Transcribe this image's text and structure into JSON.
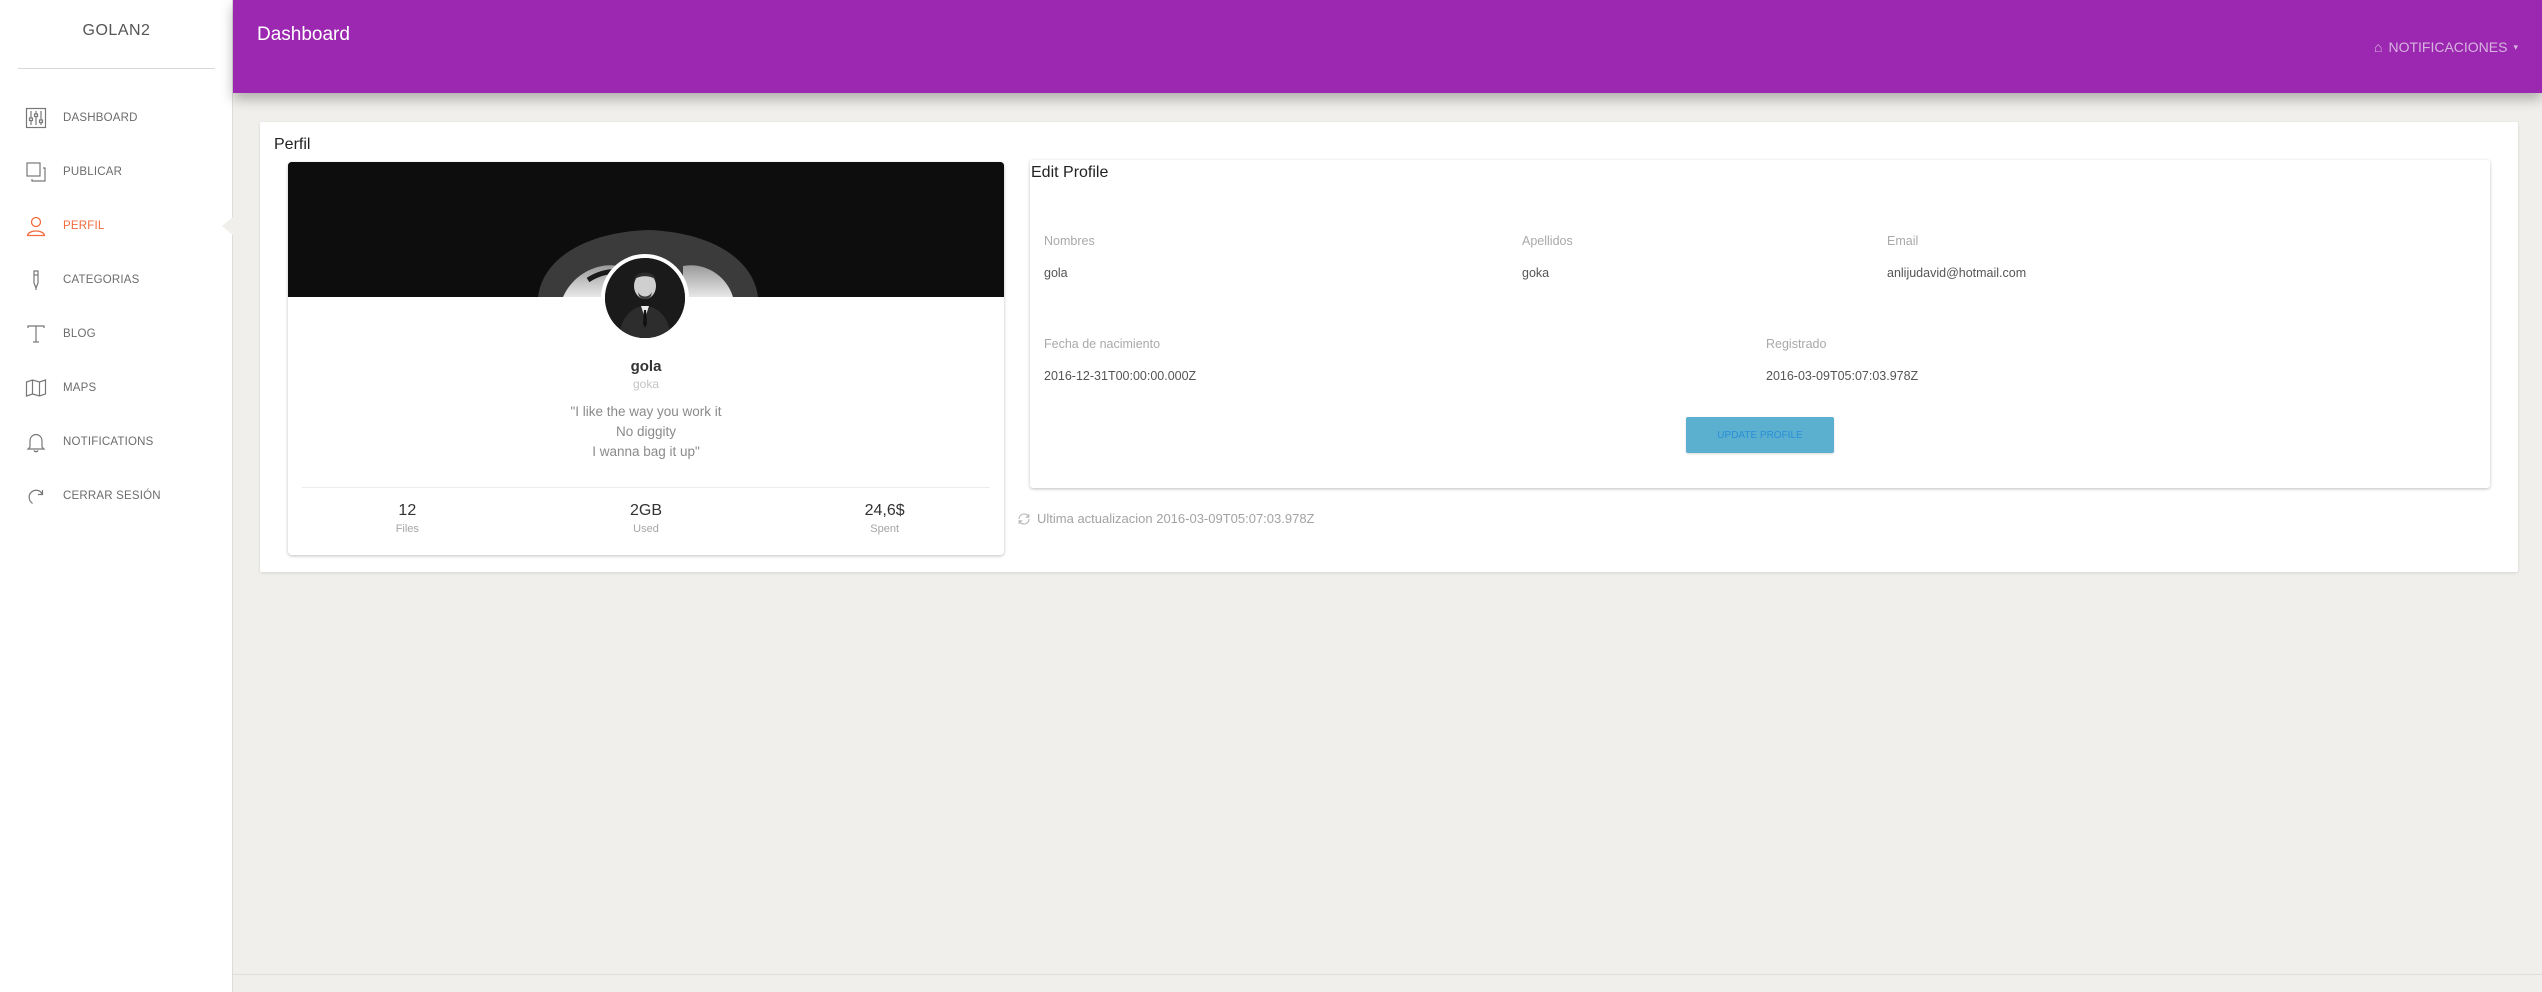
{
  "app": {
    "brand": "GOLAN2"
  },
  "sidebar": {
    "items": [
      {
        "label": "DASHBOARD",
        "icon": "sliders-icon",
        "active": false
      },
      {
        "label": "PUBLICAR",
        "icon": "copy-icon",
        "active": false
      },
      {
        "label": "PERFIL",
        "icon": "user-icon",
        "active": true
      },
      {
        "label": "CATEGORIAS",
        "icon": "pen-icon",
        "active": false
      },
      {
        "label": "BLOG",
        "icon": "text-icon",
        "active": false
      },
      {
        "label": "MAPS",
        "icon": "map-icon",
        "active": false
      },
      {
        "label": "NOTIFICATIONS",
        "icon": "bell-icon",
        "active": false
      },
      {
        "label": "CERRAR SESIÓN",
        "icon": "logout-icon",
        "active": false
      }
    ]
  },
  "topbar": {
    "title": "Dashboard",
    "notifications_label": "NOTIFICACIONES",
    "notifications_icon": "home-icon"
  },
  "page": {
    "title": "Perfil",
    "profile": {
      "name": "gola",
      "username": "goka",
      "quote_lines": [
        "\"I like the way you work it",
        "No diggity",
        "I wanna bag it up\""
      ],
      "stats": [
        {
          "value": "12",
          "label": "Files"
        },
        {
          "value": "2GB",
          "label": "Used"
        },
        {
          "value": "24,6$",
          "label": "Spent"
        }
      ]
    },
    "edit": {
      "title": "Edit Profile",
      "fields": {
        "nombres": {
          "label": "Nombres",
          "value": "gola"
        },
        "apellidos": {
          "label": "Apellidos",
          "value": "goka"
        },
        "email": {
          "label": "Email",
          "value": "anlijudavid@hotmail.com"
        },
        "nacimiento": {
          "label": "Fecha de nacimiento",
          "value": "2016-12-31T00:00:00.000Z"
        },
        "registrado": {
          "label": "Registrado",
          "value": "2016-03-09T05:07:03.978Z"
        }
      },
      "update_button": "Update Profile"
    },
    "last_update": "Ultima actualizacion 2016-03-09T05:07:03.978Z"
  },
  "colors": {
    "topbar": "#9c27b0",
    "active_nav": "#f26a3d",
    "update_button": "#5bb0cf",
    "background": "#f0efeb"
  }
}
